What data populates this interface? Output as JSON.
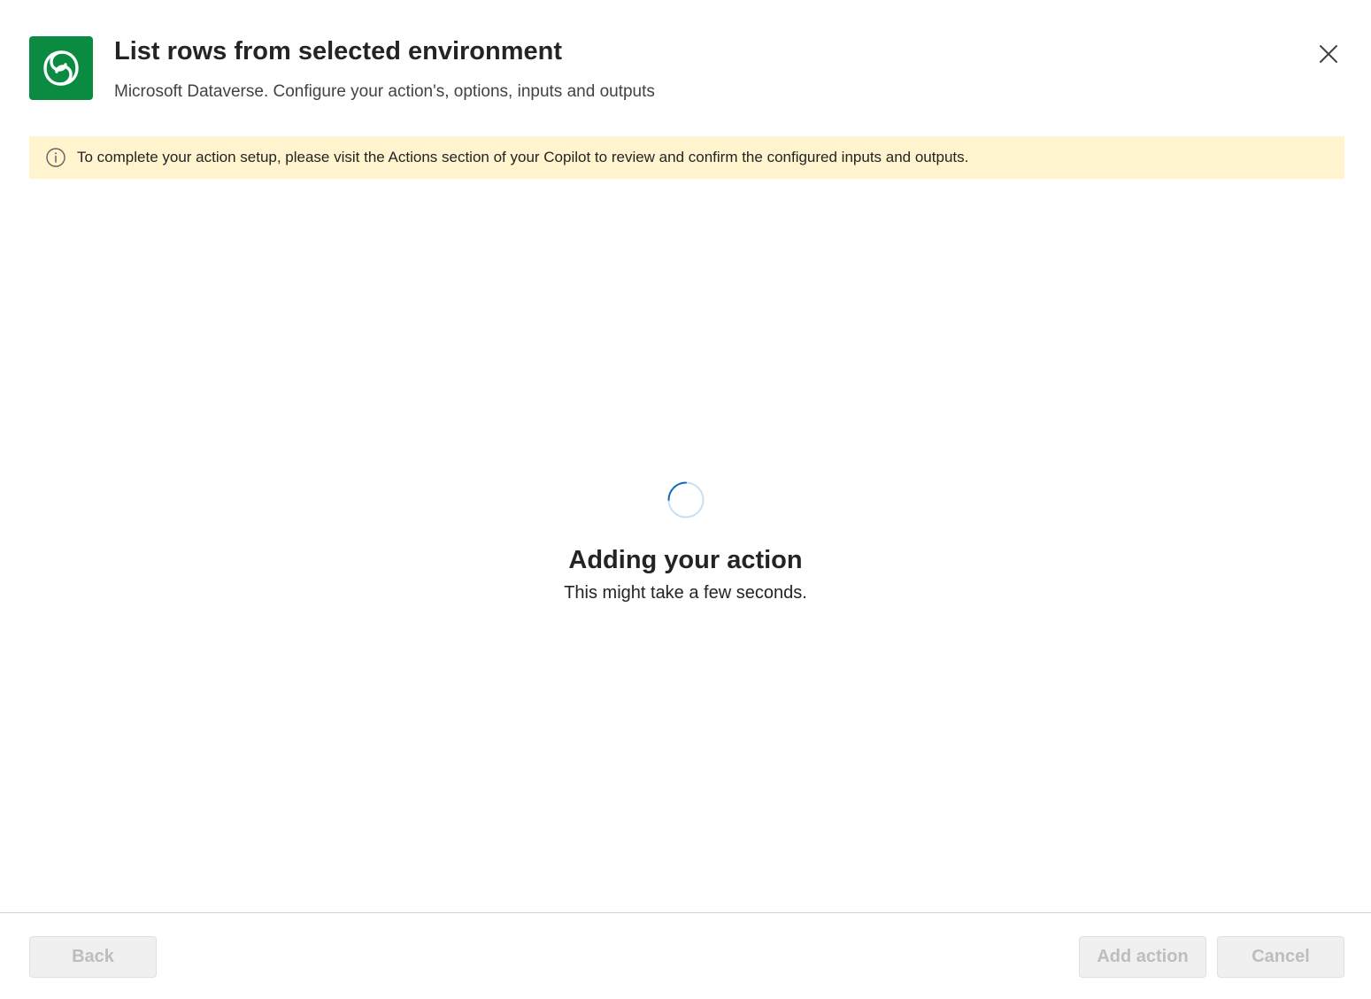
{
  "header": {
    "title": "List rows from selected environment",
    "subtitle": "Microsoft Dataverse. Configure your action's, options, inputs and outputs",
    "logo_icon": "dataverse-icon",
    "logo_color": "#0b8a42",
    "close_icon": "close-icon"
  },
  "info_bar": {
    "icon": "info-icon",
    "text": "To complete your action setup, please visit the Actions section of your Copilot to review and confirm the configured inputs and outputs.",
    "background": "#fff4ce"
  },
  "loading": {
    "spinner_icon": "spinner-icon",
    "title": "Adding your action",
    "subtitle": "This might take a few seconds."
  },
  "footer": {
    "back_label": "Back",
    "add_action_label": "Add action",
    "cancel_label": "Cancel"
  },
  "colors": {
    "accent": "#0f6cbd",
    "disabled_text": "#bdbdbd",
    "disabled_bg": "#f0f0f0"
  }
}
